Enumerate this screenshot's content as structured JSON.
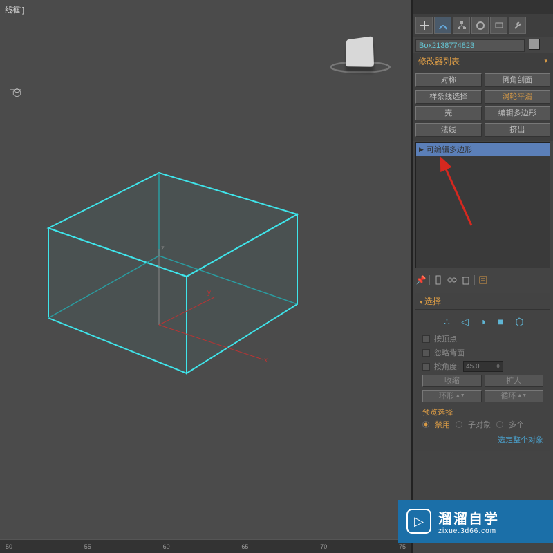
{
  "viewport": {
    "label": "线框 ]",
    "axes": {
      "x": "x",
      "y": "y",
      "z": "z"
    }
  },
  "panel": {
    "object_name": "Box2138774823",
    "modifier_list_label": "修改器列表",
    "mod_buttons": [
      {
        "label": "对称",
        "highlight": false
      },
      {
        "label": "倒角剖面",
        "highlight": false
      },
      {
        "label": "样条线选择",
        "highlight": false
      },
      {
        "label": "涡轮平滑",
        "highlight": true
      },
      {
        "label": "壳",
        "highlight": false
      },
      {
        "label": "编辑多边形",
        "highlight": false
      },
      {
        "label": "法线",
        "highlight": false
      },
      {
        "label": "挤出",
        "highlight": false
      }
    ],
    "stack": {
      "item": "可编辑多边形"
    },
    "selection": {
      "header": "选择",
      "by_vertex": "按顶点",
      "ignore_backface": "忽略背面",
      "by_angle": "按角度:",
      "angle_value": "45.0",
      "shrink": "收缩",
      "grow": "扩大",
      "ring": "环形",
      "loop": "循环",
      "preview_label": "预览选择",
      "radio_disable": "禁用",
      "radio_subobj": "子对象",
      "radio_multi": "多个",
      "select_whole": "选定整个对象"
    }
  },
  "timeline": {
    "ticks": [
      "50",
      "55",
      "60",
      "65",
      "70",
      "75"
    ]
  },
  "watermark": {
    "title": "溜溜自学",
    "url": "zixue.3d66.com"
  }
}
